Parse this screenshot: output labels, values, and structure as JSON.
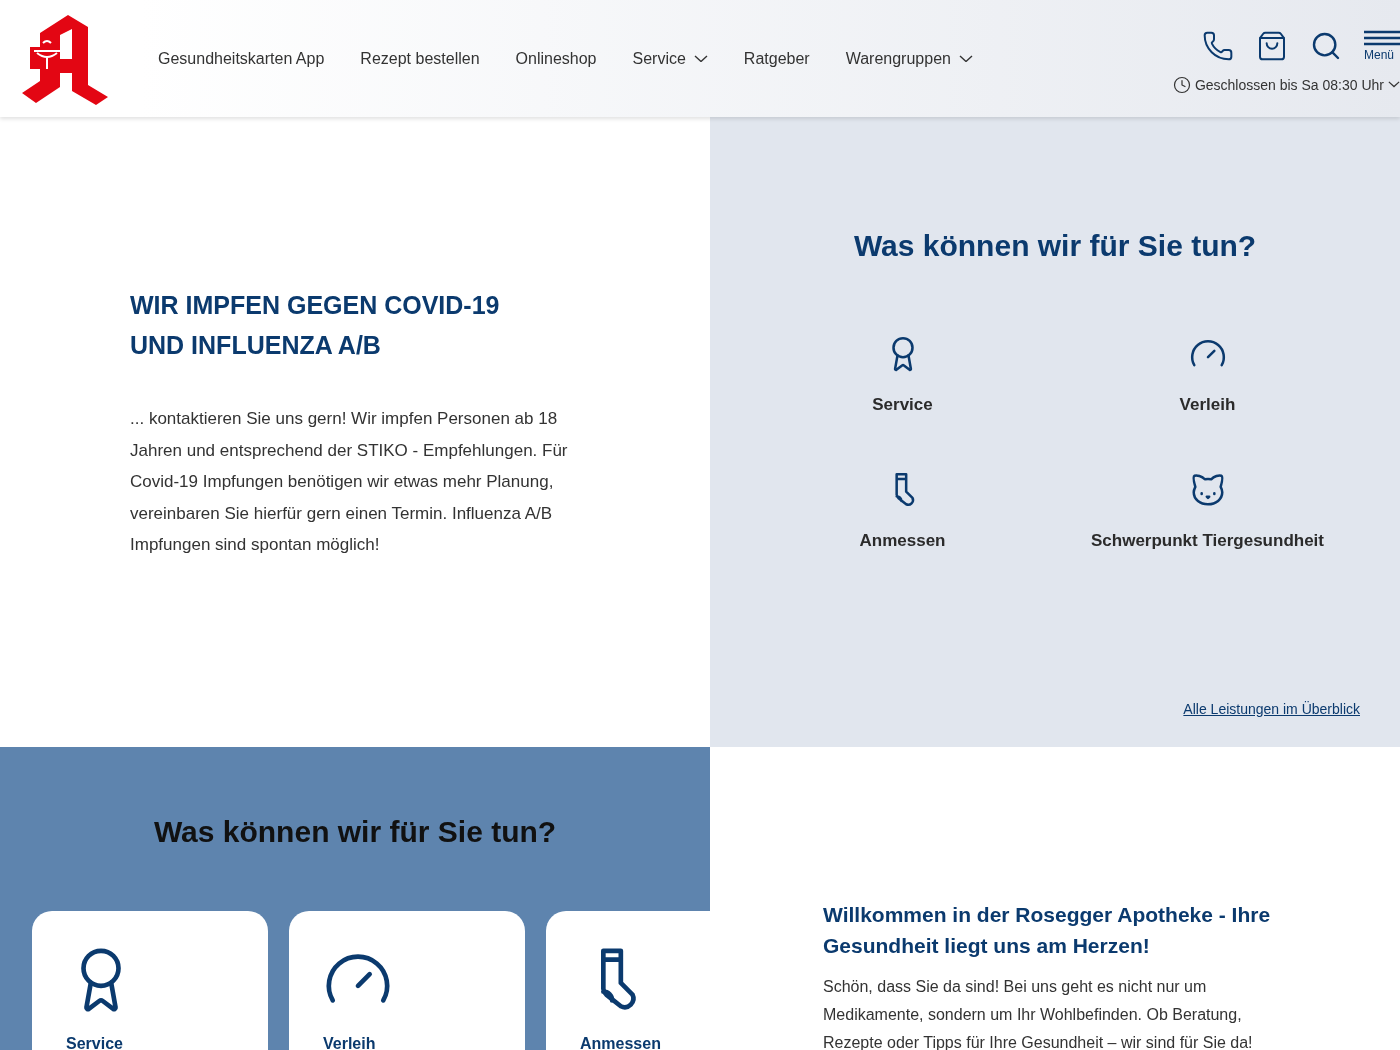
{
  "header": {
    "nav": [
      {
        "label": "Gesundheitskarten App",
        "dropdown": false
      },
      {
        "label": "Rezept bestellen",
        "dropdown": false
      },
      {
        "label": "Onlineshop",
        "dropdown": false
      },
      {
        "label": "Service",
        "dropdown": true
      },
      {
        "label": "Ratgeber",
        "dropdown": false
      },
      {
        "label": "Warengruppen",
        "dropdown": true
      }
    ],
    "menu_label": "Menü",
    "opening_status": "Geschlossen bis Sa 08:30 Uhr"
  },
  "vaccination": {
    "title": "WIR IMPFEN GEGEN COVID-19 UND INFLUENZA A/B",
    "text": "... kontaktieren Sie uns gern! Wir impfen Personen ab 18 Jahren und entsprechend der STIKO - Empfehlungen. Für Covid-19 Impfungen benötigen wir etwas mehr Planung, vereinbaren Sie hierfür gern einen Termin. Influenza A/B Impfungen sind spontan möglich!"
  },
  "services": {
    "title": "Was können wir für Sie tun?",
    "items": [
      {
        "label": "Service",
        "kind": "award"
      },
      {
        "label": "Verleih",
        "kind": "gauge"
      },
      {
        "label": "Anmessen",
        "kind": "sock"
      },
      {
        "label": "Schwerpunkt Tiergesundheit",
        "kind": "cat"
      }
    ],
    "link": "Alle Leistungen im Überblick"
  },
  "service_cards": {
    "title": "Was können wir für Sie tun?",
    "items": [
      {
        "label": "Service",
        "kind": "award"
      },
      {
        "label": "Verleih",
        "kind": "gauge"
      },
      {
        "label": "Anmessen",
        "kind": "sock"
      }
    ]
  },
  "welcome": {
    "title": "Willkommen in der Rosegger Apotheke - Ihre Gesundheit liegt uns am Herzen!",
    "text": "Schön, dass Sie da sind! Bei uns geht es nicht nur um Medikamente, sondern um Ihr Wohlbefinden. Ob Beratung, Rezepte oder Tipps für Ihre Gesundheit – wir sind für Sie da!"
  }
}
